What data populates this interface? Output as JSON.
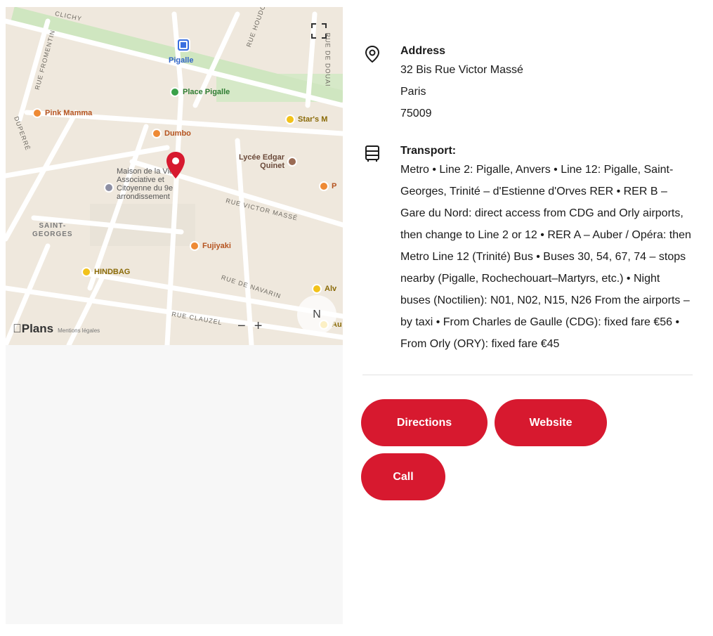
{
  "map": {
    "metro_label": "Pigalle",
    "street_labels": [
      "CLICHY",
      "RUE HOUDON",
      "RUE FROMENTIN",
      "RUE DE DOUAI",
      "DUPERRÉ",
      "RUE VICTOR MASSÉ",
      "RUE DE NAVARIN",
      "RUE CLAUZEL"
    ],
    "district_label": "SAINT-\nGEORGES",
    "pois": {
      "place_pigalle": "Place Pigalle",
      "pink_mamma": "Pink Mamma",
      "stars": "Star's M",
      "dumbo": "Dumbo",
      "lycee": "Lycée Edgar\nQuinet",
      "maison": "Maison de la Vie\nAssociative et\nCitoyenne du 9e\narrondissement",
      "p_label": "P",
      "fujiyaki": "Fujiyaki",
      "hindbag": "HINDBAG",
      "alv": "Alv",
      "au": "Au"
    },
    "brand_name": "Plans",
    "legal_label": "Mentions légales",
    "zoom_out": "−",
    "zoom_in": "+",
    "compass_label": "N",
    "expand_icon": "expand-icon"
  },
  "address": {
    "title": "Address",
    "street": "32 Bis Rue Victor Massé",
    "city": "Paris",
    "postcode": "75009"
  },
  "transport": {
    "title": "Transport:",
    "text": "Metro • Line 2: Pigalle, Anvers • Line 12: Pigalle, Saint-Georges, Trinité – d'Estienne d'Orves RER • RER B – Gare du Nord: direct access from CDG and Orly airports, then change to Line 2 or 12 • RER A – Auber / Opéra: then Metro Line 12 (Trinité) Bus • Buses 30, 54, 67, 74 – stops nearby (Pigalle, Rochechouart–Martyrs, etc.) • Night buses (Noctilien): N01, N02, N15, N26 From the airports – by taxi • From Charles de Gaulle (CDG): fixed fare €56 • From Orly (ORY): fixed fare €45"
  },
  "actions": {
    "directions": "Directions",
    "website": "Website",
    "call": "Call"
  },
  "colors": {
    "accent": "#d7192f",
    "map_bg": "#efe8dd",
    "pin": "#d7192f"
  }
}
